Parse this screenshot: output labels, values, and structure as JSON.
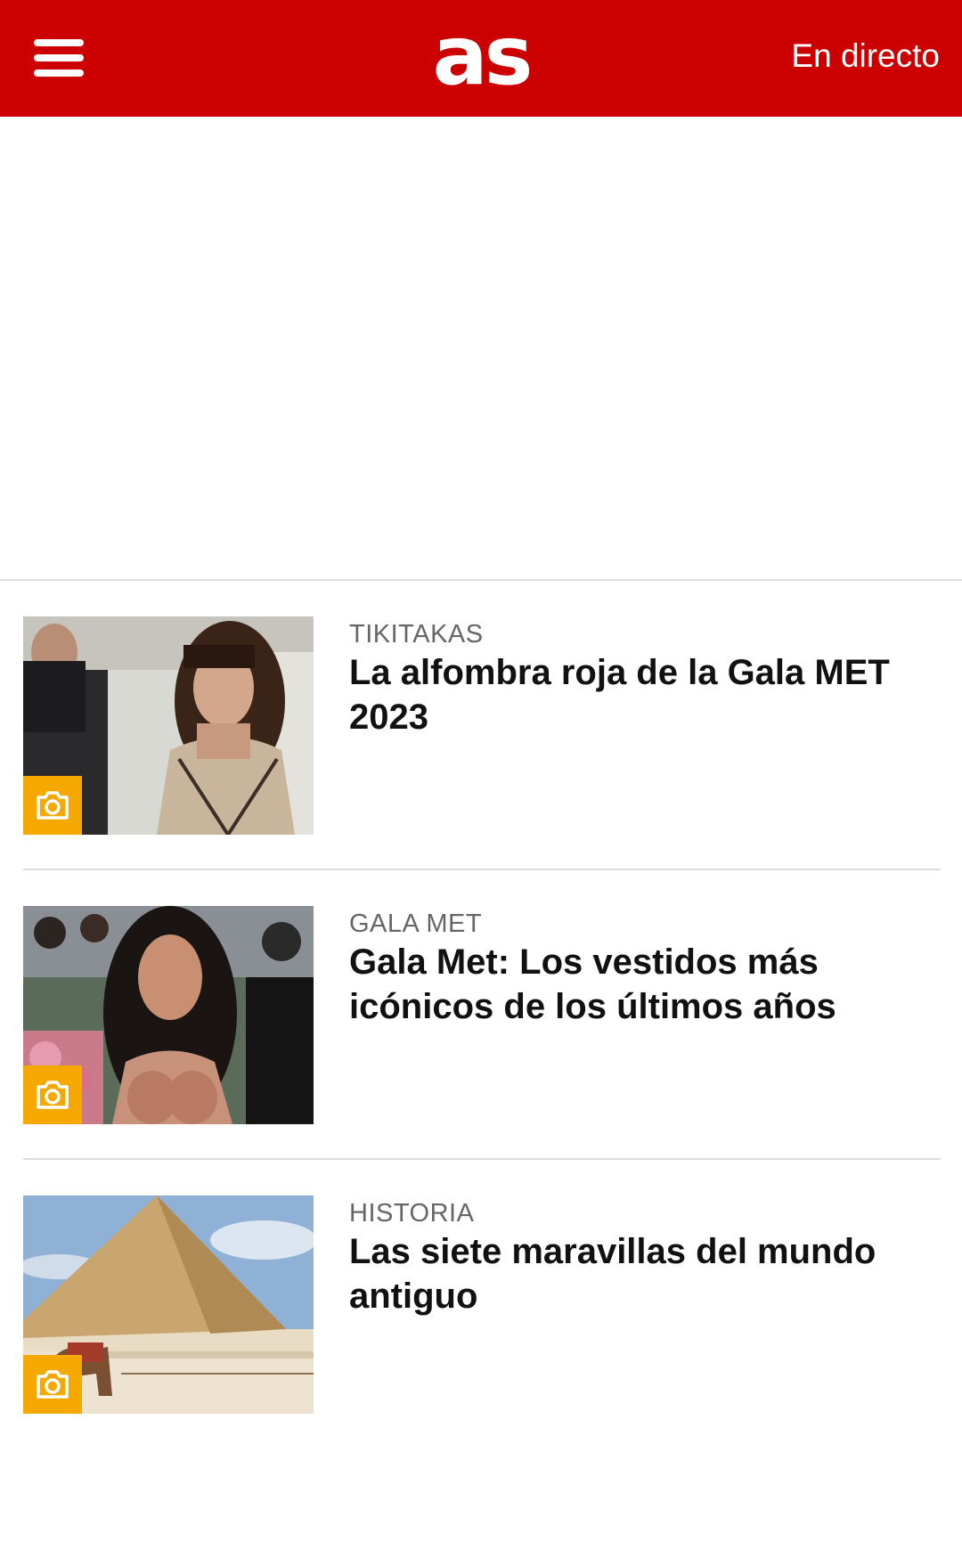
{
  "header": {
    "logo_text": "as",
    "live_link": "En directo",
    "background_color": "#cc0000",
    "menu_icon": "hamburger-menu-icon"
  },
  "articles": [
    {
      "category": "TIKITAKAS",
      "headline": "La alfombra roja de la Gala MET 2023",
      "badge_icon": "camera-icon",
      "badge_color": "#f5a800"
    },
    {
      "category": "GALA MET",
      "headline": "Gala Met: Los vestidos más icónicos de los últimos años",
      "badge_icon": "camera-icon",
      "badge_color": "#f5a800"
    },
    {
      "category": "HISTORIA",
      "headline": "Las siete maravillas del mundo antiguo",
      "badge_icon": "camera-icon",
      "badge_color": "#f5a800"
    }
  ]
}
